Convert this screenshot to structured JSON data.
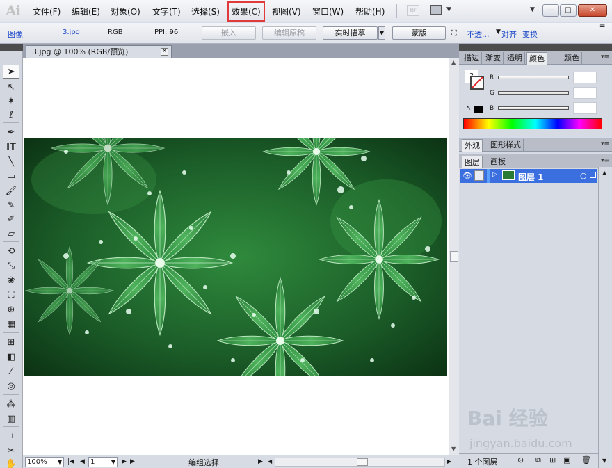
{
  "app": {
    "logo": "Ai"
  },
  "menu": [
    {
      "label": "文件(F)"
    },
    {
      "label": "编辑(E)"
    },
    {
      "label": "对象(O)"
    },
    {
      "label": "文字(T)"
    },
    {
      "label": "选择(S)"
    },
    {
      "label": "效果(C)",
      "highlighted": true
    },
    {
      "label": "视图(V)"
    },
    {
      "label": "窗口(W)"
    },
    {
      "label": "帮助(H)"
    }
  ],
  "menubar_right": {
    "bridge_label": "Br",
    "window_min": "—",
    "window_restore": "□",
    "window_close": "✕"
  },
  "controlbar": {
    "object_type": "图像",
    "file_link": "3.jpg",
    "color_mode": "RGB",
    "ppi": "PPI: 96",
    "embed_button": "嵌入",
    "edit_original_button": "编辑原稿",
    "live_trace_button": "实时描摹",
    "mask_button": "蒙版",
    "opacity_link": "不透...",
    "align_link": "对齐",
    "transform_link": "变换"
  },
  "document": {
    "tab_title": "3.jpg @ 100% (RGB/预览)",
    "tab_close": "✕"
  },
  "statusbar": {
    "zoom": "100%",
    "page": "1",
    "status_text": "编组选择"
  },
  "color_panel": {
    "tabs": [
      "描边",
      "渐变",
      "透明",
      "颜色",
      "颜色"
    ],
    "active_tab": "颜色",
    "labels": {
      "r": "R",
      "g": "G",
      "b": "B"
    }
  },
  "appearance_panel": {
    "tabs": [
      "外观",
      "图形样式"
    ]
  },
  "layers_panel": {
    "tabs": [
      "图层",
      "画板"
    ],
    "layer_name": "图层 1",
    "footer_count": "1 个图层",
    "highlight_color": "#3b6fe0"
  },
  "watermark": {
    "main": "Bai 经验",
    "sub": "jingyan.baidu.com"
  }
}
